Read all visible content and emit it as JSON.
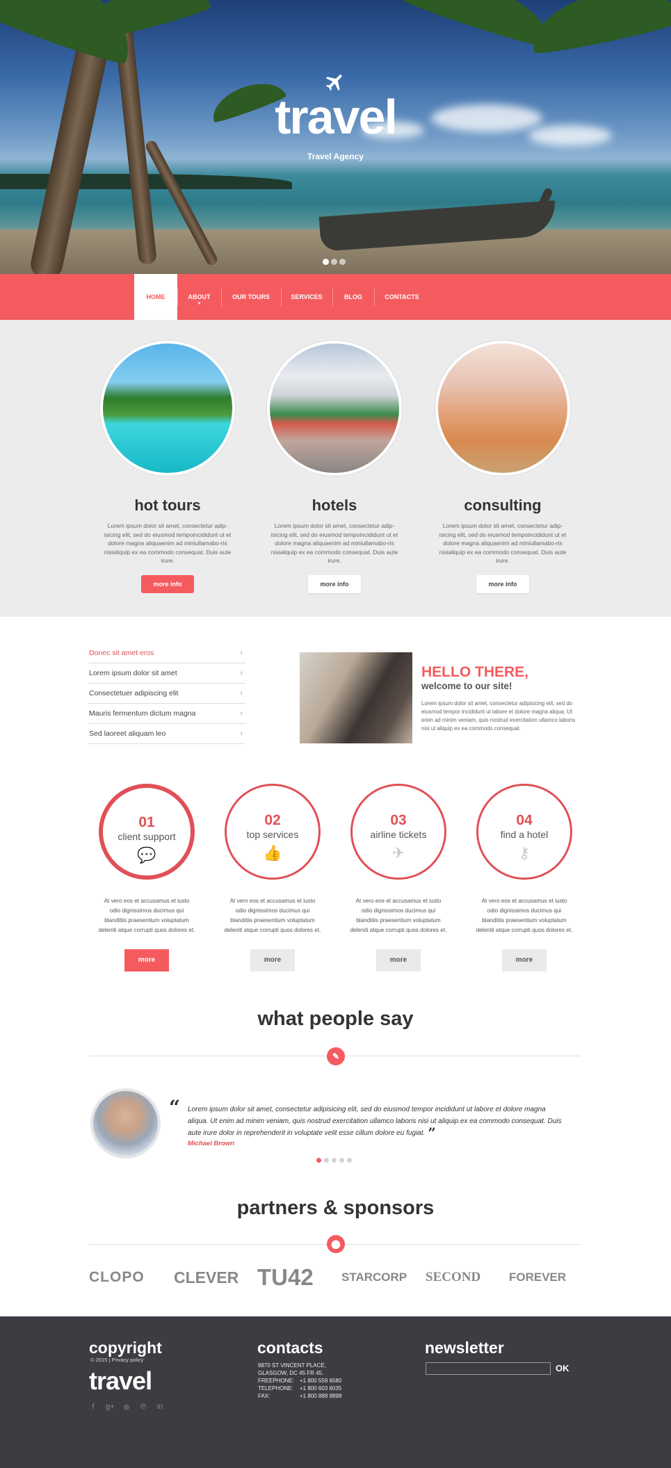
{
  "hero": {
    "title": "travel",
    "subtitle": "Travel Agency",
    "slides": 3,
    "active_slide": 1
  },
  "nav": {
    "items": [
      {
        "label": "HOME",
        "active": true
      },
      {
        "label": "ABOUT",
        "active": false
      },
      {
        "label": "OUR TOURS",
        "active": false
      },
      {
        "label": "SERVICES",
        "active": false
      },
      {
        "label": "BLOG",
        "active": false
      },
      {
        "label": "CONTACTS",
        "active": false
      }
    ]
  },
  "features": [
    {
      "title": "hot tours",
      "text": "Lorem ipsum dolor sit amet, consectetur adip-isicing elit, sed do eiusmod tempoincididunt ut et dolore magna aliquaenim ad miniullamabo-ris nisialiquip ex ea commodo consequat. Duis aute irure.",
      "button": "more info",
      "button_style": "red"
    },
    {
      "title": "hotels",
      "text": "Lorem ipsum dolor sit amet, consectetur adip-isicing elit, sed do eiusmod tempoincididunt ut et dolore magna aliquaenim ad miniullamabo-ris nisialiquip ex ea commodo consequat. Duis aute irure.",
      "button": "more info",
      "button_style": "white"
    },
    {
      "title": "consulting",
      "text": "Lorem ipsum dolor sit amet, consectetur adip-isicing elit, sed do eiusmod tempoincididunt ut et dolore magna aliquaenim ad miniullamabo-ris nisialiquip ex ea commodo consequat. Duis aute irure.",
      "button": "more info",
      "button_style": "white"
    }
  ],
  "links": [
    {
      "label": "Donec sit amet eros",
      "active": true
    },
    {
      "label": "Lorem ipsum dolor sit amet",
      "active": false
    },
    {
      "label": "Consectetuer adipiscing elit",
      "active": false
    },
    {
      "label": "Mauris fermentum dictum magna",
      "active": false
    },
    {
      "label": "Sed laoreet aliquam leo",
      "active": false
    }
  ],
  "hello": {
    "title": "HELLO THERE,",
    "subtitle": "welcome to our site!",
    "text": "Lorem ipsum dolor sit amet, consectetur adipisicing elit, sed do eiusmod tempor incididunt ut labore et dolore magna aliqua. Ut enim ad minim veniam, quis nostrud exercitation ullamco laboris nisi ut aliquip ex ea commodo consequat."
  },
  "services": [
    {
      "num": "01",
      "label": "client support",
      "icon": "chat-bubbles-icon",
      "glyph": "💬",
      "text": "At vero eos et accusamus et iusto odio dignissimos ducimus qui blanditiis praesentium voluptatum deleniti atque corrupti quos dolores et.",
      "button": "more",
      "active": true
    },
    {
      "num": "02",
      "label": "top services",
      "icon": "thumbs-up-icon",
      "glyph": "👍",
      "text": "At vero eos et accusamus et iusto odio dignissimos ducimus qui blanditiis praesentium voluptatum deleniti atque corrupti quos dolores et.",
      "button": "more",
      "active": false
    },
    {
      "num": "03",
      "label": "airline tickets",
      "icon": "paper-plane-icon",
      "glyph": "✈",
      "text": "At vero eos et accusamus et iusto odio dignissimos ducimus qui blanditiis praesentium voluptatum deleniti atque corrupti quos dolores et.",
      "button": "more",
      "active": false
    },
    {
      "num": "04",
      "label": "find a hotel",
      "icon": "key-icon",
      "glyph": "⚷",
      "text": "At vero eos et accusamus et iusto odio dignissimos ducimus qui blanditiis praesentium voluptatum deleniti atque corrupti quos dolores et.",
      "button": "more",
      "active": false
    }
  ],
  "testimonials": {
    "title": "what people say",
    "badge_icon": "pencil-icon",
    "quote": "Lorem ipsum dolor sit amet, consectetur adipisicing elit, sed do eiusmod tempor incididunt ut labore et dolore magna aliqua. Ut enim ad minim veniam, quis nostrud exercitation ullamco laboris nisi ut aliquip.ex ea commodo consequat. Duis aute irure dolor in reprehenderit in voluptate velit esse cillum dolore eu fugiat.",
    "author": "Michael Brown",
    "slides": 5,
    "active_slide": 1
  },
  "partners": {
    "title": "partners & sponsors",
    "badge_icon": "pin-icon",
    "logos": [
      "CLOPO",
      "CLEVER",
      "TU42",
      "STARCORP",
      "SECOND",
      "FOREVER"
    ]
  },
  "footer": {
    "copyright_title": "copyright",
    "copyright_text": "© 2015 | Privacy policy",
    "logo": "travel",
    "social": [
      {
        "icon": "facebook-icon",
        "glyph": "f"
      },
      {
        "icon": "google-plus-icon",
        "glyph": "g+"
      },
      {
        "icon": "rss-icon",
        "glyph": "⊚"
      },
      {
        "icon": "pinterest-icon",
        "glyph": "℗"
      },
      {
        "icon": "linkedin-icon",
        "glyph": "in"
      }
    ],
    "contacts_title": "contacts",
    "address_1": "9870 ST VINCENT PLACE,",
    "address_2": "GLASGOW, DC 45 FR 45.",
    "phones": [
      {
        "label": "FREEPHONE:",
        "value": "+1 800 559 6580"
      },
      {
        "label": "TELEPHONE:",
        "value": "+1 800 603 6035"
      },
      {
        "label": "FAX:",
        "value": "+1 800 889 9898"
      }
    ],
    "newsletter_title": "newsletter",
    "newsletter_value": "",
    "ok_label": "OK"
  },
  "colors": {
    "accent": "#f45b5f",
    "footer_bg": "#3c3c42",
    "features_bg": "#ececec"
  }
}
